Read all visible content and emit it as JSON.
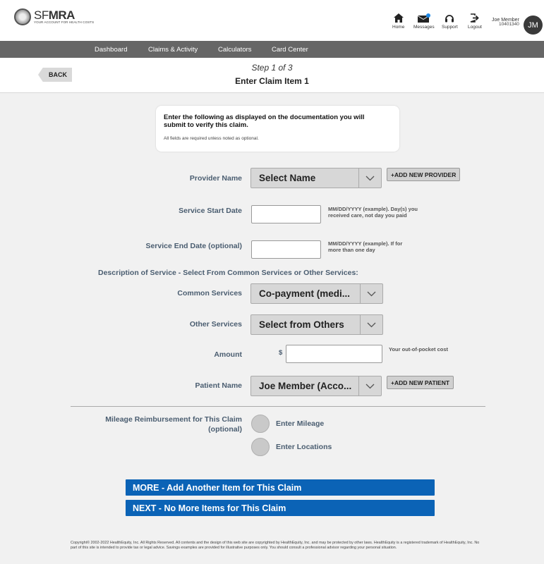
{
  "header": {
    "logo_prefix": "SF",
    "logo_bold": "MRA",
    "logo_tagline": "YOUR ACCOUNT FOR HEALTH COSTS",
    "nav": {
      "home": "Home",
      "messages": "Messages",
      "support": "Support",
      "logout": "Logout"
    },
    "user_name": "Joe Member",
    "user_id": "10401340",
    "avatar_initials": "JM"
  },
  "mainnav": {
    "dashboard": "Dashboard",
    "claims": "Claims & Activity",
    "calculators": "Calculators",
    "card_center": "Card Center"
  },
  "stepbar": {
    "back": "BACK",
    "step": "Step 1 of 3",
    "title": "Enter Claim Item 1"
  },
  "instructions": {
    "main": "Enter the  following as displayed on the documentation you will submit to verify this claim.",
    "note": "All fields are required unless noted as optional."
  },
  "form": {
    "provider_label": "Provider Name",
    "provider_value": "Select Name",
    "add_provider": "+ADD NEW PROVIDER",
    "start_label": "Service Start Date",
    "start_hint": "MM/DD/YYYY (example). Day(s) you received care, not day you paid",
    "end_label": "Service End Date (optional)",
    "end_hint": "MM/DD/YYYY (example). If for more than one day",
    "description_heading": "Description of Service - Select From Common Services or Other Services:",
    "common_label": "Common Services",
    "common_value": "Co-payment (medi...",
    "other_label": "Other Services",
    "other_value": "Select from Others",
    "amount_label": "Amount",
    "currency": "$",
    "amount_hint": "Your out-of-pocket cost",
    "patient_label": "Patient Name",
    "patient_value": "Joe Member (Acco...",
    "add_patient": "+ADD NEW PATIENT",
    "mileage_label_1": "Mileage Reimbursement for This Claim",
    "mileage_label_2": "(optional)",
    "enter_mileage": "Enter Mileage",
    "enter_locations": "Enter Locations"
  },
  "actions": {
    "more": "MORE - Add Another Item for This Claim",
    "next": "NEXT - No More Items for This Claim"
  },
  "footer": "Copyright© 2002-2022 HealthEquity, Inc. All Rights Reserved. All contents and the design of this web site are copyrighted by HealthEquity, Inc. and may be protected by other laws. HealthEquity is a registered trademark of HealthEquity, Inc. No part of this site is intended to provide tax or legal advice. Savings examples are provided for illustrative purposes only. You should consult a professional advisor regarding your personal situation.",
  "colors": {
    "accent_blue": "#0b63b6",
    "nav_grey": "#666666",
    "label_slate": "#4a5d70"
  }
}
